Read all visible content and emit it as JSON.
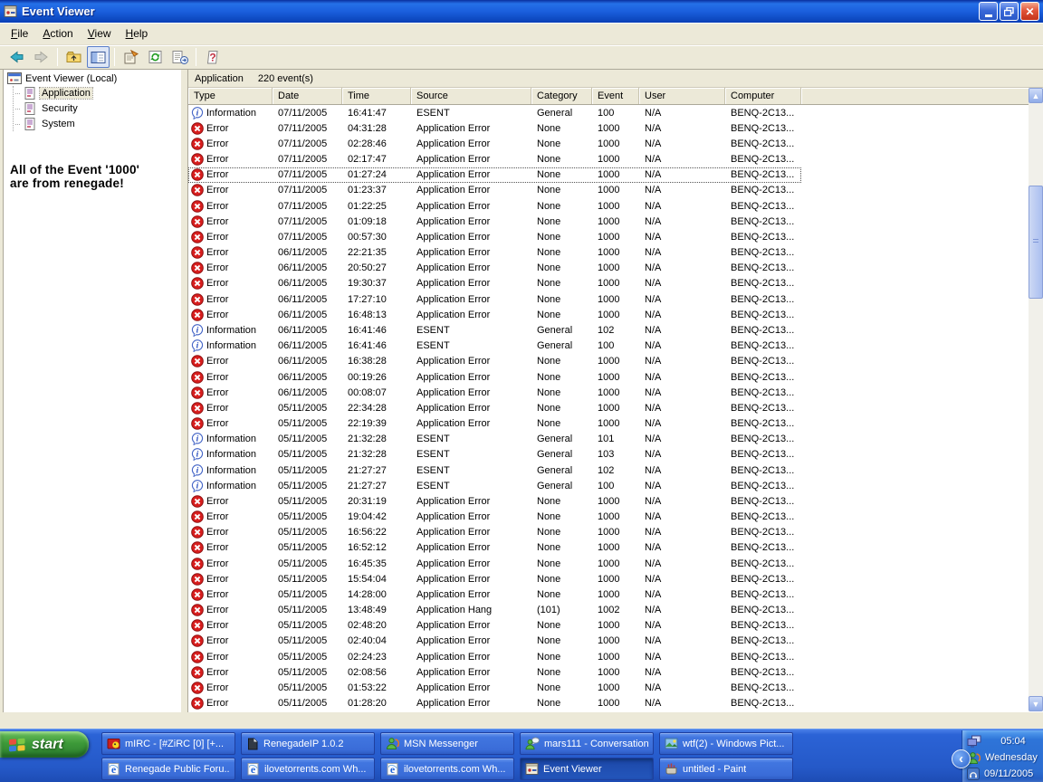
{
  "window": {
    "title": "Event Viewer",
    "menu": [
      "File",
      "Action",
      "View",
      "Help"
    ],
    "toolbar": [
      "back-icon",
      "forward-icon",
      "sep",
      "up-folder-icon",
      "show-tree-icon",
      "sep",
      "properties-icon",
      "refresh-icon",
      "export-list-icon",
      "sep",
      "help-icon"
    ],
    "controls": [
      "minimize-icon",
      "restore-icon",
      "close-icon"
    ]
  },
  "tree": {
    "root": "Event Viewer (Local)",
    "root_icon": "console-root-icon",
    "items": [
      {
        "label": "Application",
        "icon": "event-log-icon",
        "selected": true
      },
      {
        "label": "Security",
        "icon": "event-log-icon",
        "selected": false
      },
      {
        "label": "System",
        "icon": "event-log-icon",
        "selected": false
      }
    ]
  },
  "annotation": {
    "line1": "All of the Event '1000'",
    "line2": "are from renegade!"
  },
  "list": {
    "title": "Application",
    "count": "220 event(s)",
    "columns": [
      "Type",
      "Date",
      "Time",
      "Source",
      "Category",
      "Event",
      "User",
      "Computer"
    ],
    "type_icons": {
      "Information": "info-icon",
      "Error": "error-icon"
    },
    "focused_row": 4,
    "rows": [
      [
        "Information",
        "07/11/2005",
        "16:41:47",
        "ESENT",
        "General",
        "100",
        "N/A",
        "BENQ-2C13..."
      ],
      [
        "Error",
        "07/11/2005",
        "04:31:28",
        "Application Error",
        "None",
        "1000",
        "N/A",
        "BENQ-2C13..."
      ],
      [
        "Error",
        "07/11/2005",
        "02:28:46",
        "Application Error",
        "None",
        "1000",
        "N/A",
        "BENQ-2C13..."
      ],
      [
        "Error",
        "07/11/2005",
        "02:17:47",
        "Application Error",
        "None",
        "1000",
        "N/A",
        "BENQ-2C13..."
      ],
      [
        "Error",
        "07/11/2005",
        "01:27:24",
        "Application Error",
        "None",
        "1000",
        "N/A",
        "BENQ-2C13..."
      ],
      [
        "Error",
        "07/11/2005",
        "01:23:37",
        "Application Error",
        "None",
        "1000",
        "N/A",
        "BENQ-2C13..."
      ],
      [
        "Error",
        "07/11/2005",
        "01:22:25",
        "Application Error",
        "None",
        "1000",
        "N/A",
        "BENQ-2C13..."
      ],
      [
        "Error",
        "07/11/2005",
        "01:09:18",
        "Application Error",
        "None",
        "1000",
        "N/A",
        "BENQ-2C13..."
      ],
      [
        "Error",
        "07/11/2005",
        "00:57:30",
        "Application Error",
        "None",
        "1000",
        "N/A",
        "BENQ-2C13..."
      ],
      [
        "Error",
        "06/11/2005",
        "22:21:35",
        "Application Error",
        "None",
        "1000",
        "N/A",
        "BENQ-2C13..."
      ],
      [
        "Error",
        "06/11/2005",
        "20:50:27",
        "Application Error",
        "None",
        "1000",
        "N/A",
        "BENQ-2C13..."
      ],
      [
        "Error",
        "06/11/2005",
        "19:30:37",
        "Application Error",
        "None",
        "1000",
        "N/A",
        "BENQ-2C13..."
      ],
      [
        "Error",
        "06/11/2005",
        "17:27:10",
        "Application Error",
        "None",
        "1000",
        "N/A",
        "BENQ-2C13..."
      ],
      [
        "Error",
        "06/11/2005",
        "16:48:13",
        "Application Error",
        "None",
        "1000",
        "N/A",
        "BENQ-2C13..."
      ],
      [
        "Information",
        "06/11/2005",
        "16:41:46",
        "ESENT",
        "General",
        "102",
        "N/A",
        "BENQ-2C13..."
      ],
      [
        "Information",
        "06/11/2005",
        "16:41:46",
        "ESENT",
        "General",
        "100",
        "N/A",
        "BENQ-2C13..."
      ],
      [
        "Error",
        "06/11/2005",
        "16:38:28",
        "Application Error",
        "None",
        "1000",
        "N/A",
        "BENQ-2C13..."
      ],
      [
        "Error",
        "06/11/2005",
        "00:19:26",
        "Application Error",
        "None",
        "1000",
        "N/A",
        "BENQ-2C13..."
      ],
      [
        "Error",
        "06/11/2005",
        "00:08:07",
        "Application Error",
        "None",
        "1000",
        "N/A",
        "BENQ-2C13..."
      ],
      [
        "Error",
        "05/11/2005",
        "22:34:28",
        "Application Error",
        "None",
        "1000",
        "N/A",
        "BENQ-2C13..."
      ],
      [
        "Error",
        "05/11/2005",
        "22:19:39",
        "Application Error",
        "None",
        "1000",
        "N/A",
        "BENQ-2C13..."
      ],
      [
        "Information",
        "05/11/2005",
        "21:32:28",
        "ESENT",
        "General",
        "101",
        "N/A",
        "BENQ-2C13..."
      ],
      [
        "Information",
        "05/11/2005",
        "21:32:28",
        "ESENT",
        "General",
        "103",
        "N/A",
        "BENQ-2C13..."
      ],
      [
        "Information",
        "05/11/2005",
        "21:27:27",
        "ESENT",
        "General",
        "102",
        "N/A",
        "BENQ-2C13..."
      ],
      [
        "Information",
        "05/11/2005",
        "21:27:27",
        "ESENT",
        "General",
        "100",
        "N/A",
        "BENQ-2C13..."
      ],
      [
        "Error",
        "05/11/2005",
        "20:31:19",
        "Application Error",
        "None",
        "1000",
        "N/A",
        "BENQ-2C13..."
      ],
      [
        "Error",
        "05/11/2005",
        "19:04:42",
        "Application Error",
        "None",
        "1000",
        "N/A",
        "BENQ-2C13..."
      ],
      [
        "Error",
        "05/11/2005",
        "16:56:22",
        "Application Error",
        "None",
        "1000",
        "N/A",
        "BENQ-2C13..."
      ],
      [
        "Error",
        "05/11/2005",
        "16:52:12",
        "Application Error",
        "None",
        "1000",
        "N/A",
        "BENQ-2C13..."
      ],
      [
        "Error",
        "05/11/2005",
        "16:45:35",
        "Application Error",
        "None",
        "1000",
        "N/A",
        "BENQ-2C13..."
      ],
      [
        "Error",
        "05/11/2005",
        "15:54:04",
        "Application Error",
        "None",
        "1000",
        "N/A",
        "BENQ-2C13..."
      ],
      [
        "Error",
        "05/11/2005",
        "14:28:00",
        "Application Error",
        "None",
        "1000",
        "N/A",
        "BENQ-2C13..."
      ],
      [
        "Error",
        "05/11/2005",
        "13:48:49",
        "Application Hang",
        "(101)",
        "1002",
        "N/A",
        "BENQ-2C13..."
      ],
      [
        "Error",
        "05/11/2005",
        "02:48:20",
        "Application Error",
        "None",
        "1000",
        "N/A",
        "BENQ-2C13..."
      ],
      [
        "Error",
        "05/11/2005",
        "02:40:04",
        "Application Error",
        "None",
        "1000",
        "N/A",
        "BENQ-2C13..."
      ],
      [
        "Error",
        "05/11/2005",
        "02:24:23",
        "Application Error",
        "None",
        "1000",
        "N/A",
        "BENQ-2C13..."
      ],
      [
        "Error",
        "05/11/2005",
        "02:08:56",
        "Application Error",
        "None",
        "1000",
        "N/A",
        "BENQ-2C13..."
      ],
      [
        "Error",
        "05/11/2005",
        "01:53:22",
        "Application Error",
        "None",
        "1000",
        "N/A",
        "BENQ-2C13..."
      ],
      [
        "Error",
        "05/11/2005",
        "01:28:20",
        "Application Error",
        "None",
        "1000",
        "N/A",
        "BENQ-2C13..."
      ]
    ]
  },
  "taskbar": {
    "start_label": "start",
    "start_icon": "windows-flag-icon",
    "row1": [
      {
        "label": "mIRC - [#ZiRC [0] [+...",
        "icon": "mirc-icon",
        "active": false
      },
      {
        "label": "RenegadeIP 1.0.2",
        "icon": "renegadeip-icon",
        "active": false
      },
      {
        "label": "MSN Messenger",
        "icon": "msn-buddy-icon",
        "active": false
      },
      {
        "label": "mars111 - Conversation",
        "icon": "conversation-icon",
        "active": false
      },
      {
        "label": "wtf(2) - Windows Pict...",
        "icon": "picture-viewer-icon",
        "active": false
      }
    ],
    "row2": [
      {
        "label": "Renegade Public Foru...",
        "icon": "ie-icon",
        "active": false
      },
      {
        "label": "ilovetorrents.com Wh...",
        "icon": "ie-icon",
        "active": false
      },
      {
        "label": "ilovetorrents.com Wh...",
        "icon": "ie-icon",
        "active": false
      },
      {
        "label": "Event Viewer",
        "icon": "event-viewer-icon",
        "active": true
      },
      {
        "label": "untitled - Paint",
        "icon": "paint-icon",
        "active": false
      }
    ],
    "tray": {
      "chevron_icon": "chevron-left-icon",
      "icons": [
        "monitors-icon",
        "msn-buddy-icon",
        "headphones-icon"
      ],
      "time": "05:04",
      "day": "Wednesday",
      "date": "09/11/2005"
    }
  }
}
